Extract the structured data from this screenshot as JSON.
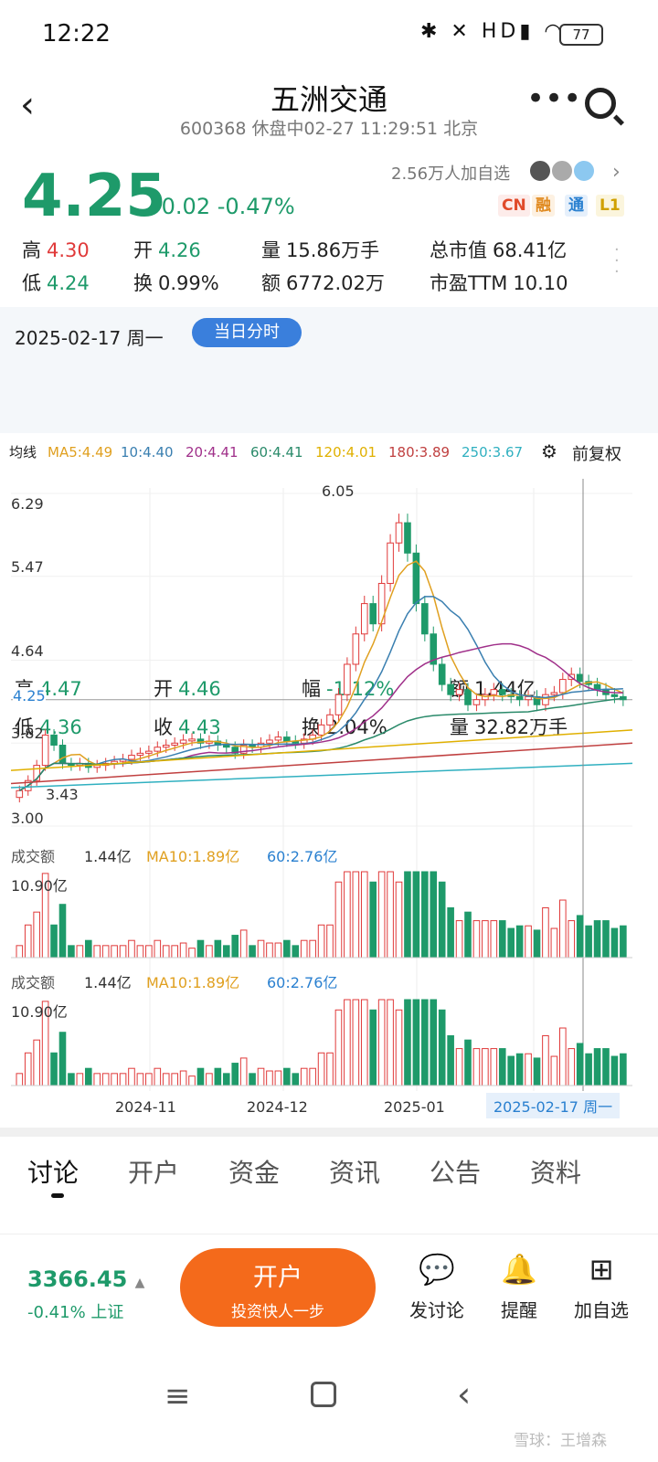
{
  "status_bar": {
    "time": "12:22",
    "icons": "✱ ✕ HD▮ ◠",
    "battery": "77"
  },
  "header": {
    "back": "‹",
    "title": "五洲交通",
    "subtitle": "600368 休盘中02-27 11:29:51 北京",
    "more": "•••"
  },
  "quote": {
    "price": "4.25",
    "change": "-0.02",
    "change_pct": "-0.47%",
    "followers": "2.56万人加自选",
    "tags": [
      "CN",
      "融",
      "通",
      "L1"
    ],
    "stats": [
      {
        "label": "高",
        "value": "4.30",
        "color": "red"
      },
      {
        "label": "开",
        "value": "4.26",
        "color": "green"
      },
      {
        "label": "量",
        "value": "15.86万手",
        "color": "black"
      },
      {
        "label": "总市值",
        "value": "68.41亿",
        "color": "black"
      },
      {
        "label": "低",
        "value": "4.24",
        "color": "green"
      },
      {
        "label": "换",
        "value": "0.99%",
        "color": "black"
      },
      {
        "label": "额",
        "value": "6772.02万",
        "color": "black"
      },
      {
        "label": "市盈TTM",
        "value": "10.10",
        "color": "black"
      }
    ]
  },
  "day_panel": {
    "date": "2025-02-17 周一",
    "button": "当日分时",
    "stats": [
      {
        "label": "高",
        "value": "4.47",
        "color": "green"
      },
      {
        "label": "开",
        "value": "4.46",
        "color": "green"
      },
      {
        "label": "幅",
        "value": "-1.12%",
        "color": "green"
      },
      {
        "label": "额",
        "value": "1.44亿",
        "color": "black"
      },
      {
        "label": "低",
        "value": "4.36",
        "color": "green"
      },
      {
        "label": "收",
        "value": "4.43",
        "color": "green"
      },
      {
        "label": "换",
        "value": "2.04%",
        "color": "black"
      },
      {
        "label": "量",
        "value": "32.82万手",
        "color": "black"
      }
    ]
  },
  "ma_legend": {
    "title": "均线",
    "items": [
      {
        "text": "MA5:4.49",
        "color": "#e0a020"
      },
      {
        "text": "10:4.40",
        "color": "#3a7fb0"
      },
      {
        "text": "20:4.41",
        "color": "#a0308a"
      },
      {
        "text": "60:4.41",
        "color": "#2a8a6a"
      },
      {
        "text": "120:4.01",
        "color": "#e0b000"
      },
      {
        "text": "180:3.89",
        "color": "#c04040"
      },
      {
        "text": "250:3.67",
        "color": "#30b0c0"
      }
    ],
    "fq": "前复权"
  },
  "chart_data": {
    "type": "candlestick",
    "y_ticks": [
      "6.29",
      "5.47",
      "4.64",
      "3.82",
      "3.00"
    ],
    "ylim": [
      3.0,
      6.29
    ],
    "high_marker": "6.05",
    "low_marker": "3.43",
    "current_label": "4.25",
    "current": 4.25,
    "x_labels": [
      "2024-11",
      "2024-12",
      "2025-01"
    ],
    "cursor_label": "2025-02-17 周一",
    "closes": [
      3.35,
      3.45,
      3.6,
      3.9,
      3.8,
      3.62,
      3.6,
      3.62,
      3.58,
      3.6,
      3.62,
      3.64,
      3.66,
      3.7,
      3.72,
      3.74,
      3.78,
      3.8,
      3.82,
      3.85,
      3.86,
      3.82,
      3.84,
      3.8,
      3.78,
      3.72,
      3.8,
      3.78,
      3.82,
      3.85,
      3.88,
      3.84,
      3.82,
      3.86,
      3.9,
      4.0,
      4.1,
      4.3,
      4.6,
      4.9,
      5.2,
      5.0,
      5.4,
      5.8,
      6.0,
      5.7,
      5.2,
      4.9,
      4.6,
      4.4,
      4.3,
      4.35,
      4.2,
      4.25,
      4.3,
      4.35,
      4.3,
      4.28,
      4.25,
      4.28,
      4.2,
      4.3,
      4.32,
      4.45,
      4.5,
      4.43,
      4.4,
      4.35,
      4.3,
      4.28,
      4.25
    ],
    "volume_panel": {
      "title": "成交额",
      "value": "1.44亿",
      "ma10": "MA10:1.89亿",
      "ma60": "60:2.76亿",
      "max": "10.90亿"
    }
  },
  "tabs": [
    "讨论",
    "开户",
    "资金",
    "资讯",
    "公告",
    "资料"
  ],
  "bottom": {
    "index_value": "3366.45",
    "index_arrow": "▲",
    "index_change": "-0.41% 上证",
    "open_title": "开户",
    "open_sub": "投资快人一步",
    "actions": [
      {
        "label": "发讨论",
        "icon": "chat-icon"
      },
      {
        "label": "提醒",
        "icon": "bell-icon"
      },
      {
        "label": "加自选",
        "icon": "plus-box-icon"
      }
    ]
  },
  "watermark": "雪球：王增森"
}
